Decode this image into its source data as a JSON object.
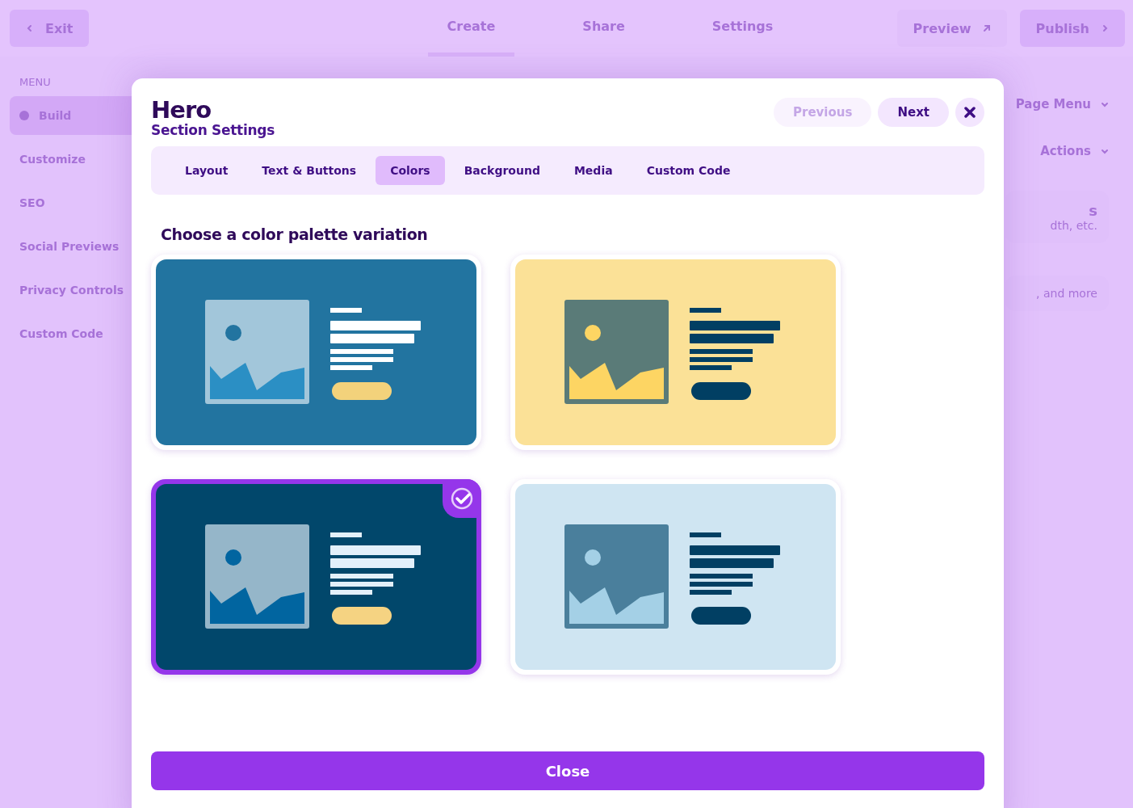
{
  "topbar": {
    "exit": "Exit",
    "tabs": [
      {
        "label": "Create",
        "selected": true
      },
      {
        "label": "Share",
        "selected": false
      },
      {
        "label": "Settings",
        "selected": false
      }
    ],
    "preview": "Preview",
    "publish": "Publish"
  },
  "sidebar": {
    "heading": "MENU",
    "items": [
      {
        "label": "Build",
        "selected": true
      },
      {
        "label": "Customize",
        "selected": false
      },
      {
        "label": "SEO",
        "selected": false
      },
      {
        "label": "Social Previews",
        "selected": false
      },
      {
        "label": "Privacy Controls",
        "selected": false
      },
      {
        "label": "Custom Code",
        "selected": false
      }
    ]
  },
  "right_panel": {
    "page_menu": "Page Menu",
    "actions": "Actions",
    "card_1_title": "s",
    "card_1_text": "dth, etc.",
    "card_2_text": ", and more"
  },
  "modal": {
    "title": "Hero",
    "subtitle": "Section Settings",
    "previous": {
      "label": "Previous",
      "disabled": true
    },
    "next": "Next",
    "tabs": [
      {
        "label": "Layout",
        "selected": false
      },
      {
        "label": "Text & Buttons",
        "selected": false
      },
      {
        "label": "Colors",
        "selected": true
      },
      {
        "label": "Background",
        "selected": false
      },
      {
        "label": "Media",
        "selected": false
      },
      {
        "label": "Custom Code",
        "selected": false
      }
    ],
    "heading": "Choose a color palette variation",
    "palettes": [
      {
        "selected": false
      },
      {
        "selected": false
      },
      {
        "selected": true
      },
      {
        "selected": false
      }
    ],
    "close": "Close"
  }
}
